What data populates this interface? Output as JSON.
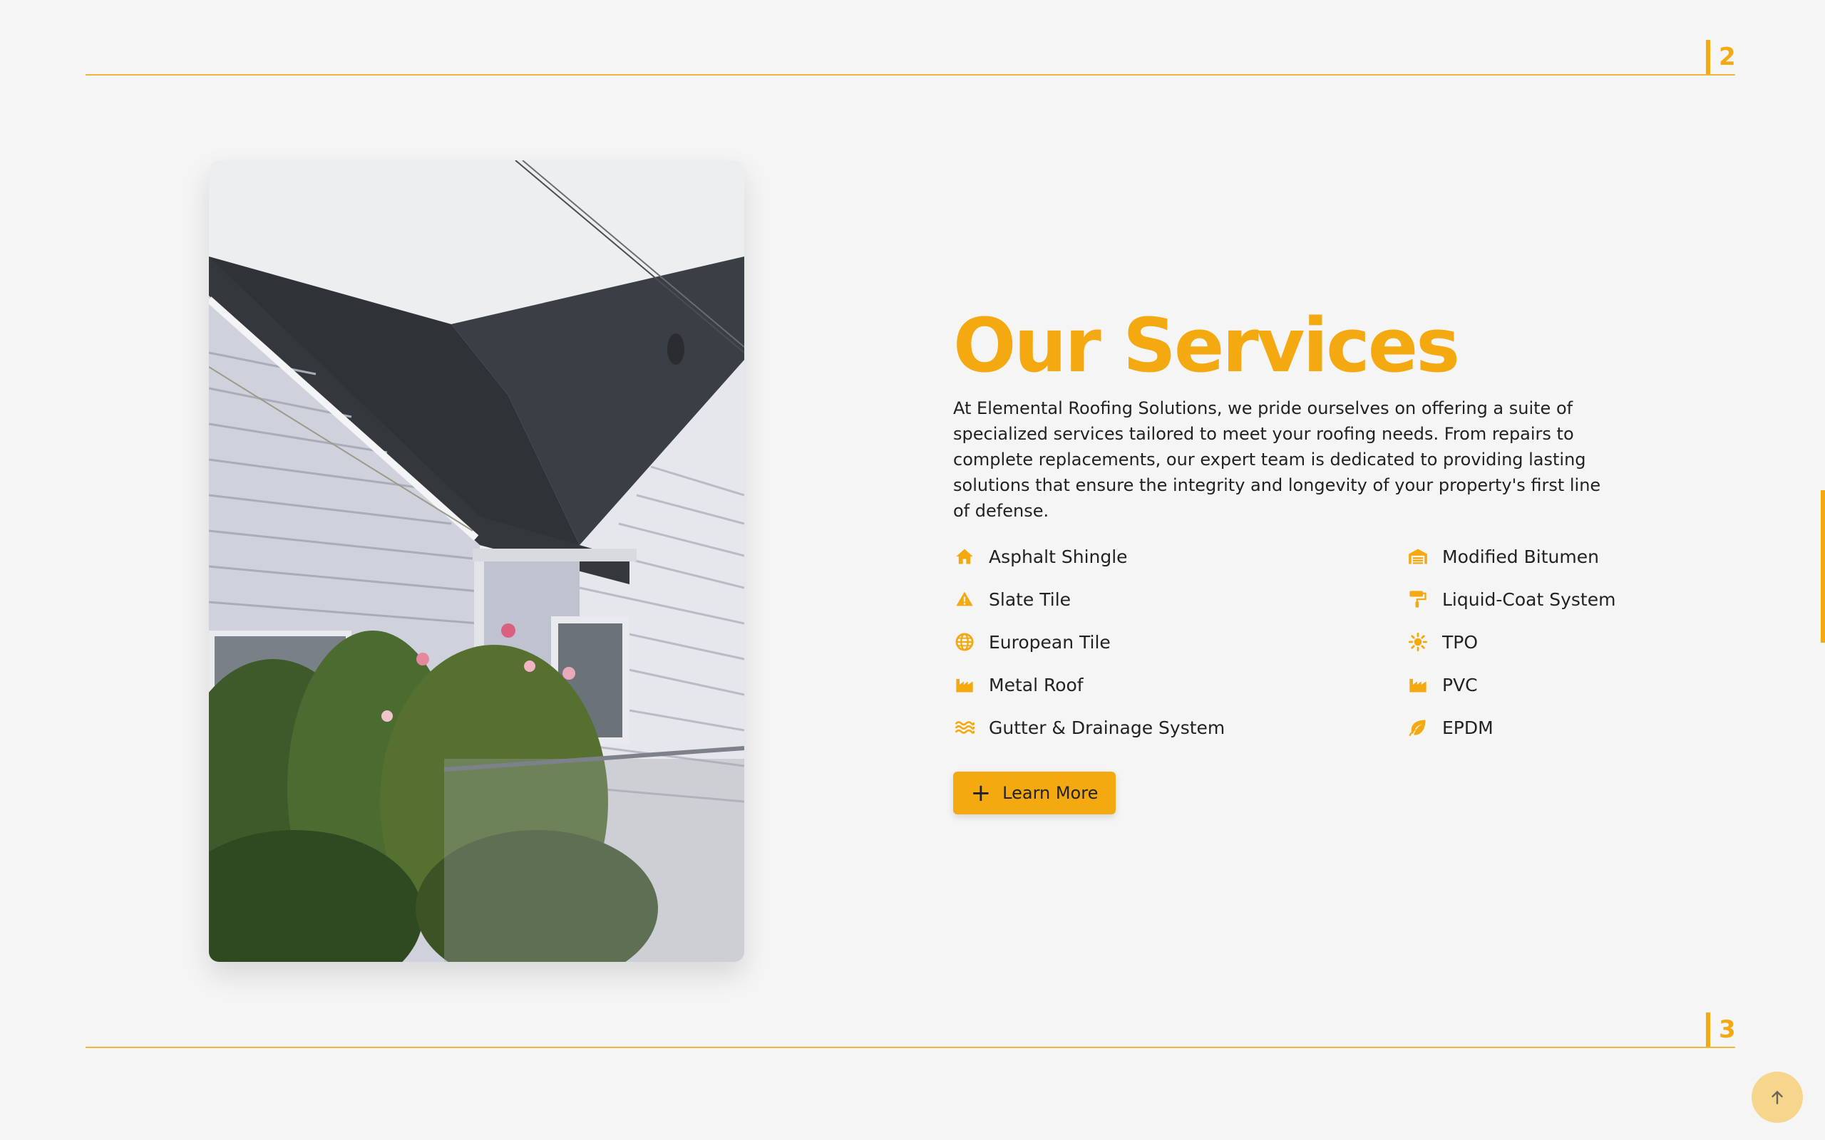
{
  "sections": {
    "top_number": "2",
    "bottom_number": "3"
  },
  "main": {
    "title": "Our Services",
    "description": "At Elemental Roofing Solutions, we pride ourselves on offering a suite of specialized services tailored to meet your roofing needs. From repairs to complete replacements, our expert team is dedicated to providing lasting solutions that ensure the integrity and longevity of your property's first line of defense.",
    "services_left": [
      {
        "label": "Asphalt Shingle",
        "icon": "house-icon"
      },
      {
        "label": "Slate Tile",
        "icon": "warning-triangle-icon"
      },
      {
        "label": "European Tile",
        "icon": "globe-icon"
      },
      {
        "label": "Metal Roof",
        "icon": "factory-icon"
      },
      {
        "label": "Gutter & Drainage System",
        "icon": "water-waves-icon"
      }
    ],
    "services_right": [
      {
        "label": "Modified Bitumen",
        "icon": "warehouse-icon"
      },
      {
        "label": "Liquid-Coat System",
        "icon": "paint-roller-icon"
      },
      {
        "label": "TPO",
        "icon": "sun-icon"
      },
      {
        "label": "PVC",
        "icon": "factory-icon"
      },
      {
        "label": "EPDM",
        "icon": "leaf-icon"
      }
    ],
    "button_label": "Learn More",
    "button_icon": "plus-icon"
  },
  "photo": {
    "subject": "house-roof-photo"
  },
  "colors": {
    "accent": "#f4a911",
    "background": "#f5f5f5",
    "rule": "#f2b63a",
    "to_top_bg": "#f6d58c"
  },
  "scroll_to_top": {
    "icon": "arrow-up-icon"
  }
}
